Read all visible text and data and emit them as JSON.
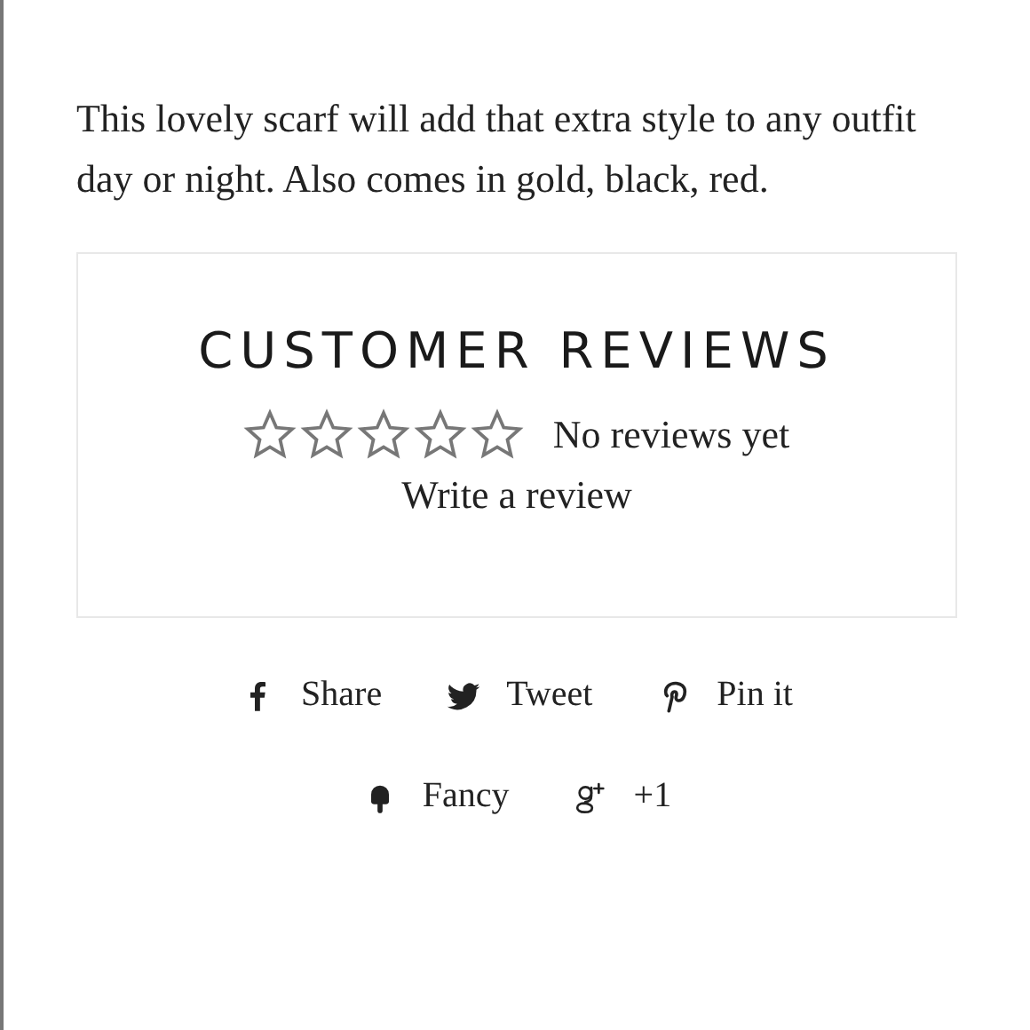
{
  "description": "This lovely scarf will add that extra style to any outfit day or night. Also comes in gold, black, red.",
  "reviews": {
    "title": "CUSTOMER REVIEWS",
    "stars": 0,
    "summary": "No reviews yet",
    "link": "Write a review"
  },
  "share_buttons": [
    {
      "kind": "facebook",
      "label": "Share"
    },
    {
      "kind": "twitter",
      "label": "Tweet"
    },
    {
      "kind": "pinterest",
      "label": "Pin it"
    },
    {
      "kind": "fancy",
      "label": "Fancy"
    },
    {
      "kind": "googleplus",
      "label": "+1"
    }
  ]
}
